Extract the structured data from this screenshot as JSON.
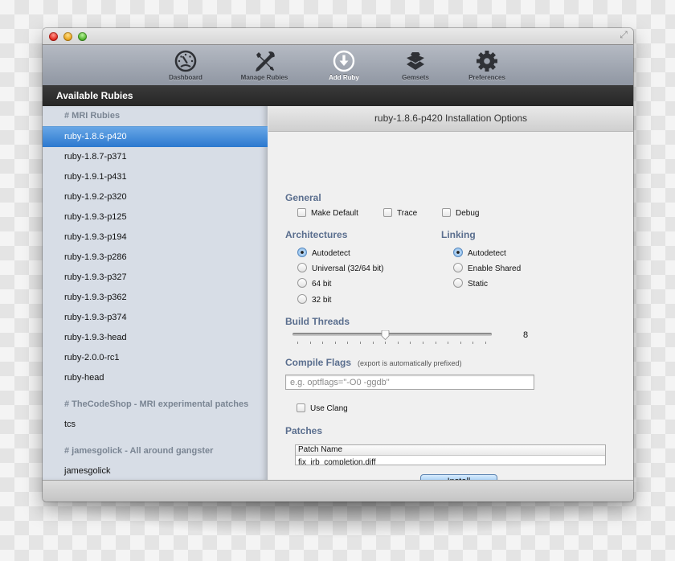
{
  "window": {
    "controls": [
      "close",
      "minimize",
      "maximize"
    ],
    "fullscreen_icon": "fullscreen-icon"
  },
  "toolbar": {
    "items": [
      {
        "label": "Dashboard",
        "icon": "dashboard-gauge-icon",
        "active": false
      },
      {
        "label": "Manage Rubies",
        "icon": "wrench-screwdriver-icon",
        "active": false
      },
      {
        "label": "Add Ruby",
        "icon": "download-arrow-circle-icon",
        "active": true
      },
      {
        "label": "Gemsets",
        "icon": "gem-box-icon",
        "active": false
      },
      {
        "label": "Preferences",
        "icon": "gear-icon",
        "active": false
      }
    ]
  },
  "section_title": "Available Rubies",
  "sidebar": {
    "groups": [
      {
        "header": "# MRI Rubies",
        "items": [
          "ruby-1.8.6-p420",
          "ruby-1.8.7-p371",
          "ruby-1.9.1-p431",
          "ruby-1.9.2-p320",
          "ruby-1.9.3-p125",
          "ruby-1.9.3-p194",
          "ruby-1.9.3-p286",
          "ruby-1.9.3-p327",
          "ruby-1.9.3-p362",
          "ruby-1.9.3-p374",
          "ruby-1.9.3-head",
          "ruby-2.0.0-rc1",
          "ruby-head"
        ]
      },
      {
        "header": "# TheCodeShop - MRI experimental patches",
        "items": [
          "tcs"
        ]
      },
      {
        "header": "# jamesgolick - All around gangster",
        "items": [
          "jamesgolick"
        ]
      }
    ],
    "selected": "ruby-1.8.6-p420"
  },
  "main": {
    "title": "ruby-1.8.6-p420 Installation Options",
    "general": {
      "label": "General",
      "options": [
        {
          "label": "Make Default",
          "checked": false
        },
        {
          "label": "Trace",
          "checked": false
        },
        {
          "label": "Debug",
          "checked": false
        }
      ]
    },
    "architectures": {
      "label": "Architectures",
      "options": [
        {
          "label": "Autodetect",
          "selected": true
        },
        {
          "label": "Universal (32/64 bit)",
          "selected": false
        },
        {
          "label": "64 bit",
          "selected": false
        },
        {
          "label": "32 bit",
          "selected": false
        }
      ]
    },
    "linking": {
      "label": "Linking",
      "options": [
        {
          "label": "Autodetect",
          "selected": true
        },
        {
          "label": "Enable Shared",
          "selected": false
        },
        {
          "label": "Static",
          "selected": false
        }
      ]
    },
    "build_threads": {
      "label": "Build Threads",
      "value": 8,
      "min": 1,
      "max": 16,
      "value_text": "8"
    },
    "compile_flags": {
      "label": "Compile Flags",
      "hint": "(export is automatically prefixed)",
      "value": "",
      "placeholder": "e.g. optflags=\"-O0 -ggdb\""
    },
    "use_clang": {
      "label": "Use Clang",
      "checked": false
    },
    "patches": {
      "label": "Patches",
      "column": "Patch Name",
      "rows": [
        "fix_irb_completion.diff"
      ]
    },
    "install_label": "Install"
  }
}
